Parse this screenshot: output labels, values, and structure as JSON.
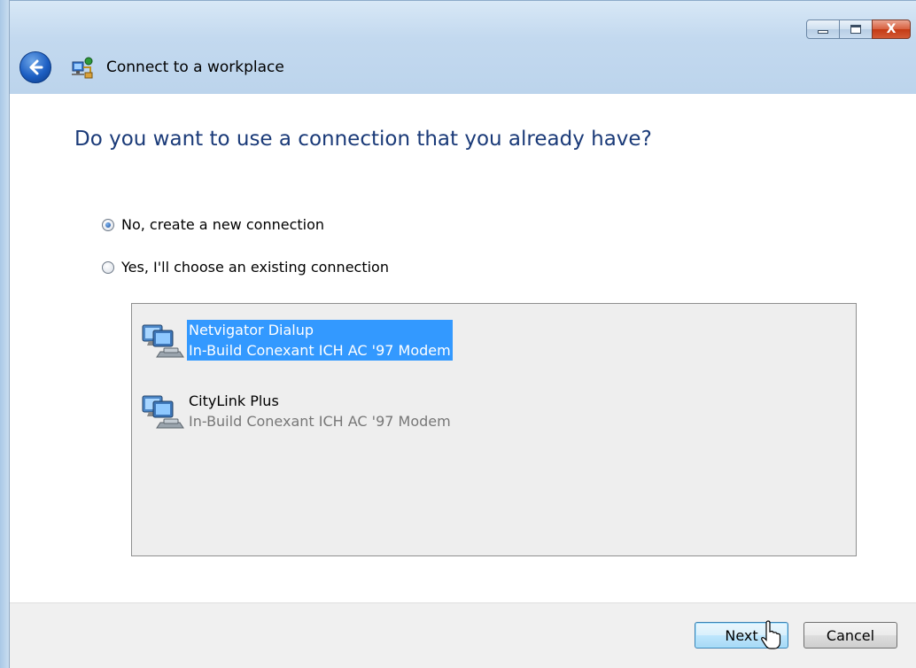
{
  "window": {
    "title": "Connect to a workplace",
    "icon": "network-workplace-icon"
  },
  "titlebar": {
    "minimize_icon": "minimize-icon",
    "maximize_icon": "maximize-icon",
    "close_glyph": "X"
  },
  "page": {
    "heading": "Do you want to use a connection that you already have?"
  },
  "options": [
    {
      "label": "No, create a new connection",
      "selected": true
    },
    {
      "label": "Yes, I'll choose an existing connection",
      "selected": false
    }
  ],
  "connections": [
    {
      "name": "Netvigator Dialup",
      "device": "In-Build Conexant ICH AC '97 Modem",
      "selected": true
    },
    {
      "name": "CityLink Plus",
      "device": "In-Build Conexant ICH AC '97 Modem",
      "selected": false
    }
  ],
  "footer": {
    "next_label": "Next",
    "cancel_label": "Cancel"
  },
  "colors": {
    "heading": "#1a3a78",
    "selection": "#3399ff",
    "list_background": "#eeeeee"
  }
}
